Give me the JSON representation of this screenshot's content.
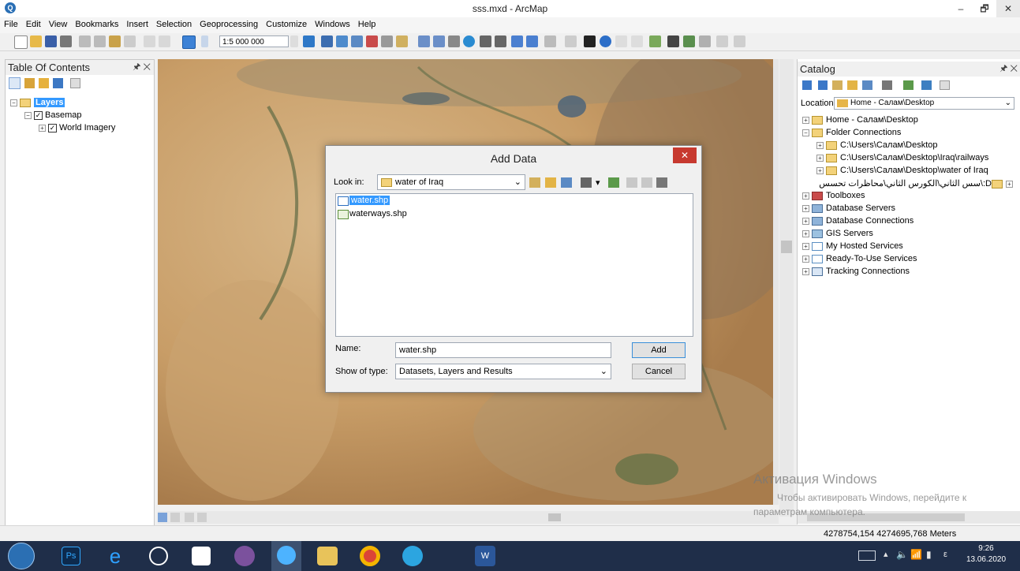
{
  "window": {
    "title": "sss.mxd - ArcMap",
    "app_icon": "Q",
    "min": "–",
    "max": "🗗",
    "close": "✕"
  },
  "menu": [
    "File",
    "Edit",
    "View",
    "Bookmarks",
    "Insert",
    "Selection",
    "Geoprocessing",
    "Customize",
    "Windows",
    "Help"
  ],
  "toolbar": {
    "scale": "1:5 000 000"
  },
  "toc": {
    "title": "Table Of Contents",
    "pin": "🖈 ✕",
    "layers_label": "Layers",
    "basemap_label": "Basemap",
    "imagery_label": "World Imagery"
  },
  "catalog": {
    "title": "Catalog",
    "pin": "🖈 ✕",
    "location_label": "Location:",
    "location_value": "Home - Салам\\Desktop",
    "items": [
      "Home - Салам\\Desktop",
      "Folder Connections",
      "C:\\Users\\Салам\\Desktop",
      "C:\\Users\\Салам\\Desktop\\Iraq\\railways",
      "C:\\Users\\Салам\\Desktop\\water of Iraq",
      "D:\\سس الثاني\\الكورس الثاني\\محاظرات تحسس",
      "Toolboxes",
      "Database Servers",
      "Database Connections",
      "GIS Servers",
      "My Hosted Services",
      "Ready-To-Use Services",
      "Tracking Connections"
    ]
  },
  "dialog": {
    "title": "Add Data",
    "close": "✕",
    "look_in_label": "Look in:",
    "look_in_value": "water of Iraq",
    "files": [
      "water.shp",
      "waterways.shp"
    ],
    "name_label": "Name:",
    "name_value": "water.shp",
    "type_label": "Show of type:",
    "type_value": "Datasets, Layers and Results",
    "add_button": "Add",
    "cancel_button": "Cancel"
  },
  "activation": {
    "line1": "Активация Windows",
    "line2": "Чтобы активировать Windows, перейдите к",
    "line3": "параметрам компьютера."
  },
  "status": {
    "coords": "4278754,154  4274695,768 Meters"
  },
  "tray": {
    "time": "9:26",
    "date": "13.06.2020",
    "lang": "ε"
  },
  "colors": {
    "accent": "#2a6fb5",
    "dialog_close": "#c7392f",
    "taskbar": "#1f2e49"
  }
}
